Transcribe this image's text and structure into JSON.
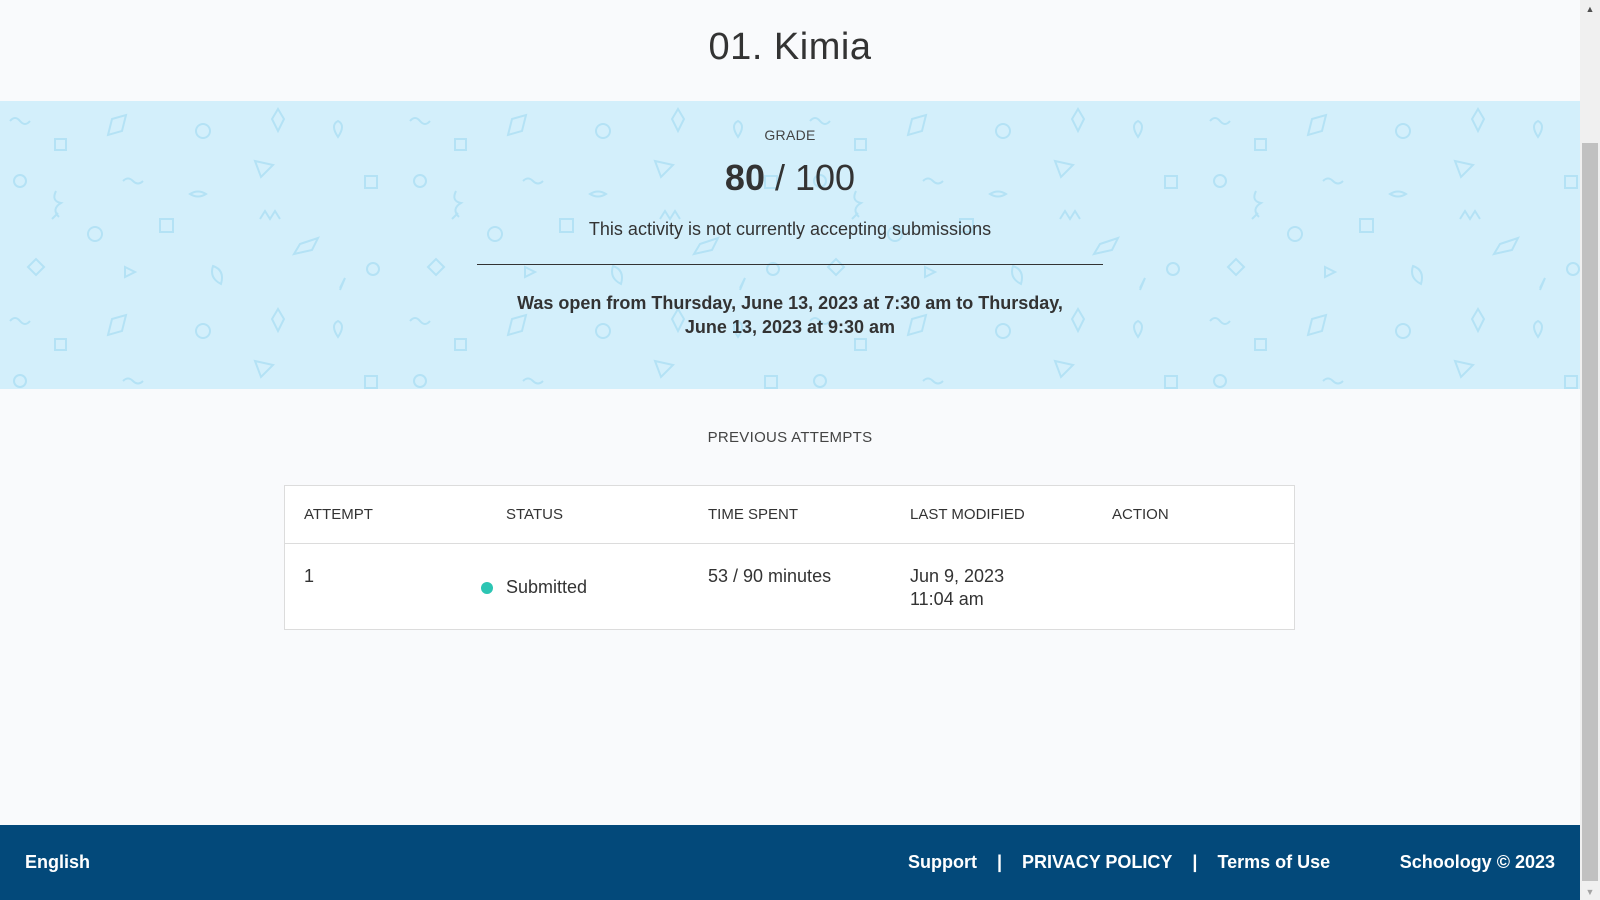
{
  "header": {
    "title": "01. Kimia"
  },
  "grade": {
    "label": "GRADE",
    "earned": "80",
    "separator": "/",
    "possible": "100",
    "notice": "This activity is not currently accepting submissions",
    "open_range": "Was open from Thursday, June 13, 2023 at 7:30 am to Thursday, June 13, 2023 at 9:30 am"
  },
  "attempts": {
    "title": "PREVIOUS ATTEMPTS",
    "columns": [
      "ATTEMPT",
      "STATUS",
      "TIME SPENT",
      "LAST MODIFIED",
      "ACTION"
    ],
    "rows": [
      {
        "attempt": "1",
        "status": "Submitted",
        "status_color": "#2cc5b3",
        "time_spent": "53 / 90 minutes",
        "modified_date": "Jun 9, 2023",
        "modified_time": "11:04 am",
        "action": ""
      }
    ]
  },
  "footer": {
    "language": "English",
    "support": "Support",
    "pipe": "|",
    "privacy": "PRIVACY POLICY",
    "terms": "Terms of Use",
    "copyright": "Schoology © 2023"
  },
  "colors": {
    "hero_bg": "#d3effb",
    "footer_bg": "#03497a",
    "accent_shapes": "#a8dcf2"
  },
  "scrollbar": {
    "up_icon": "triangle-up-icon",
    "down_icon": "triangle-down-icon"
  }
}
